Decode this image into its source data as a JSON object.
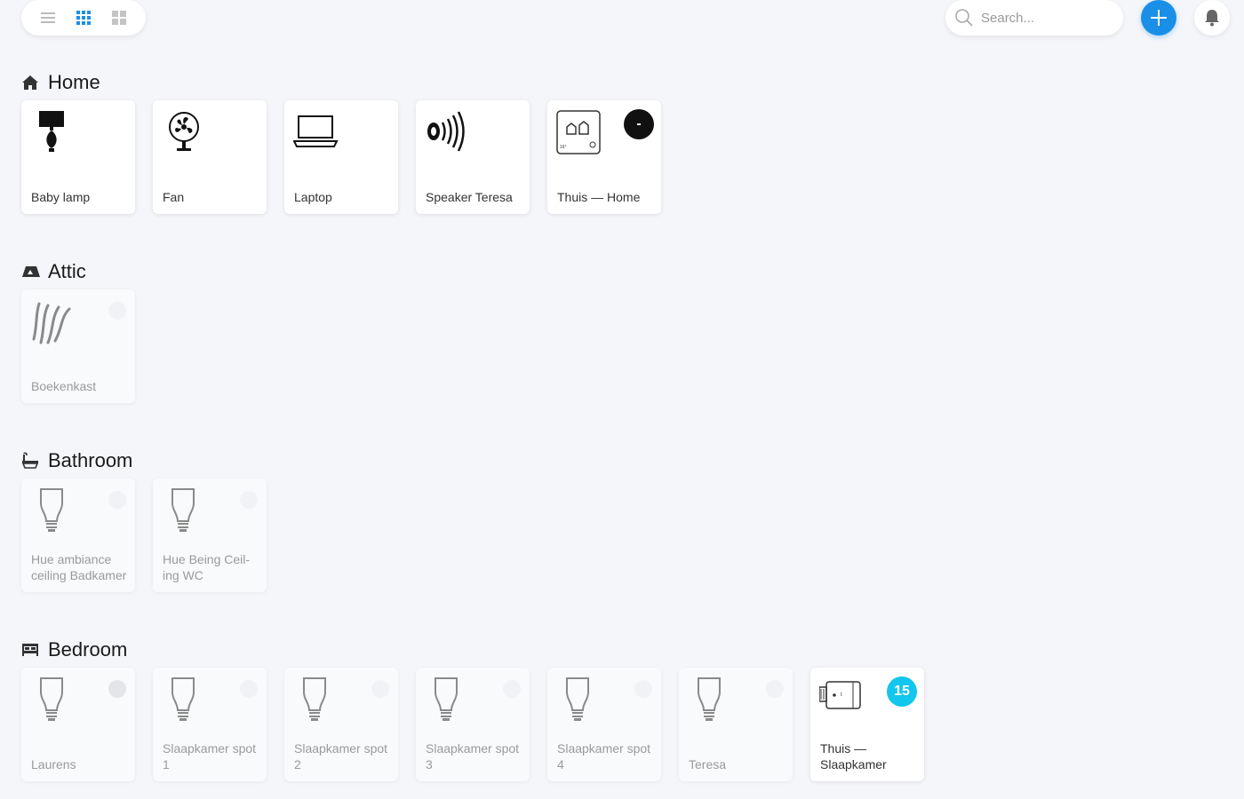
{
  "topbar": {
    "view_list_icon": "list-icon",
    "view_grid_small_icon": "grid-small-icon",
    "view_grid_large_icon": "grid-large-icon",
    "search_placeholder": "Search...",
    "add_icon": "plus-icon",
    "notifications_icon": "bell-icon"
  },
  "colors": {
    "accent": "#1a8fe8",
    "badge_cyan": "#12c6ee",
    "badge_dark": "#111111"
  },
  "sections": [
    {
      "title": "Home",
      "icon": "home-icon",
      "devices": [
        {
          "label": "Baby lamp",
          "icon": "table-lamp-icon",
          "state": "on"
        },
        {
          "label": "Fan",
          "icon": "fan-icon",
          "state": "on"
        },
        {
          "label": "Laptop",
          "icon": "laptop-icon",
          "state": "on"
        },
        {
          "label": "Speaker Teresa",
          "icon": "speaker-icon",
          "state": "on"
        },
        {
          "label": "Thuis — Home",
          "icon": "thermostat-icon",
          "state": "on",
          "badge": "-"
        }
      ]
    },
    {
      "title": "Attic",
      "icon": "attic-icon",
      "devices": [
        {
          "label": "Boekenkast",
          "icon": "light-strip-icon",
          "state": "off"
        }
      ]
    },
    {
      "title": "Bathroom",
      "icon": "bathtub-icon",
      "devices": [
        {
          "label": "Hue ambiance ceiling Badkamer",
          "icon": "bulb-icon",
          "state": "off"
        },
        {
          "label": "Hue Being Ceil-ing WC",
          "icon": "bulb-icon",
          "state": "off"
        }
      ]
    },
    {
      "title": "Bedroom",
      "icon": "bed-icon",
      "devices": [
        {
          "label": "Laurens",
          "icon": "bulb-icon",
          "state": "off"
        },
        {
          "label": "Slaapkamer spot 1",
          "icon": "bulb-icon",
          "state": "off"
        },
        {
          "label": "Slaapkamer spot 2",
          "icon": "bulb-icon",
          "state": "off"
        },
        {
          "label": "Slaapkamer spot 3",
          "icon": "bulb-icon",
          "state": "off"
        },
        {
          "label": "Slaapkamer spot 4",
          "icon": "bulb-icon",
          "state": "off"
        },
        {
          "label": "Teresa",
          "icon": "bulb-icon",
          "state": "off"
        },
        {
          "label": "Thuis — Slaapkamer",
          "icon": "radiator-valve-icon",
          "state": "on",
          "badge": "15"
        }
      ]
    }
  ]
}
